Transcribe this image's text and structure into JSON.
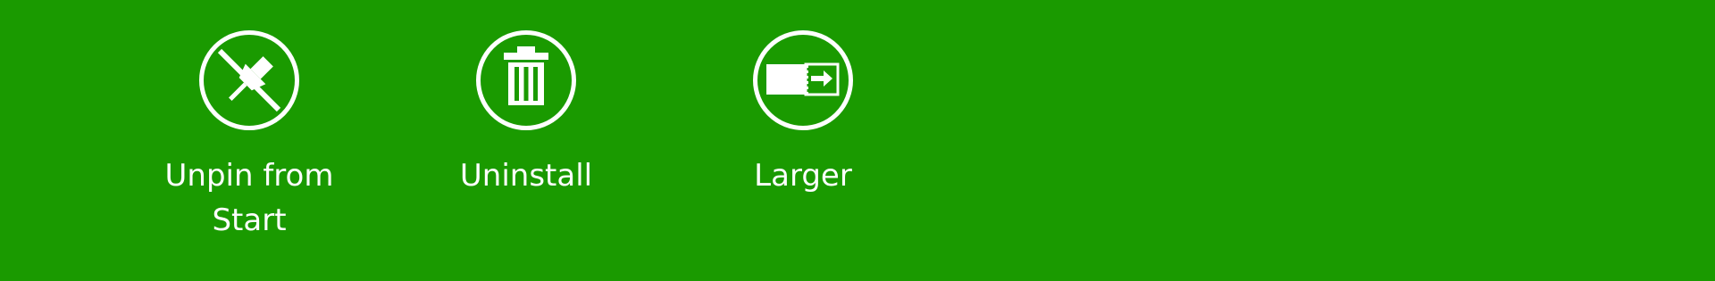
{
  "app_bar": {
    "background_color": "#1a9a00",
    "foreground_color": "#ffffff",
    "commands": [
      {
        "label": "Unpin from Start",
        "icon": "unpin-icon"
      },
      {
        "label": "Uninstall",
        "icon": "trash-icon"
      },
      {
        "label": "Larger",
        "icon": "resize-larger-icon"
      }
    ]
  }
}
